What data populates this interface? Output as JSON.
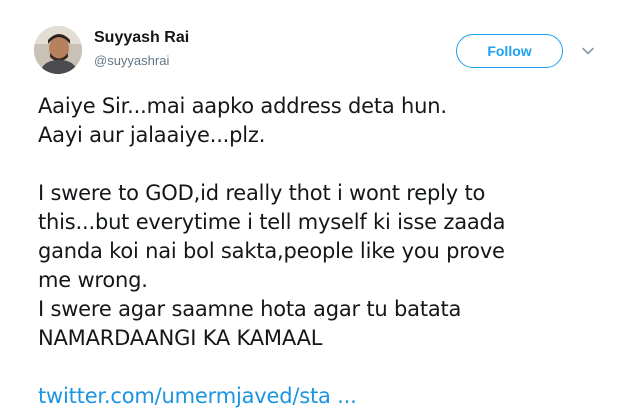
{
  "author": {
    "display_name": "Suyyash Rai",
    "handle": "@suyyashrai",
    "avatar_icon": "profile-photo"
  },
  "actions": {
    "follow_label": "Follow",
    "menu_icon": "chevron-down-icon"
  },
  "tweet": {
    "lines": [
      "Aaiye Sir...mai aapko address deta hun.",
      "Aayi aur jalaaiye...plz.",
      "",
      "I swere to GOD,id really thot i wont reply to",
      "this...but everytime i tell myself ki isse zaada",
      "ganda koi nai bol sakta,people like you prove",
      "me wrong.",
      "I swere agar saamne hota agar tu batata",
      "NAMARDAANGI KA KAMAAL"
    ],
    "link_text": "twitter.com/umermjaved/sta ..."
  },
  "colors": {
    "accent": "#1da1f2",
    "link": "#1b95e0",
    "text": "#14171a",
    "secondary_text": "#657786"
  }
}
